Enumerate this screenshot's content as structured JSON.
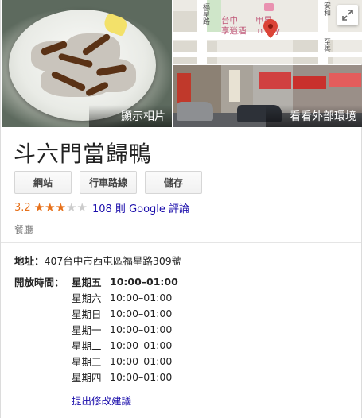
{
  "header": {
    "photo_label": "顯示相片",
    "streetview_label": "看看外部環境",
    "map": {
      "place_label_line1": "台中",
      "place_label_line1b": "甲星",
      "place_label_line2": "享逍酒",
      "place_label_line2b": "n Sky",
      "street_label_1": "福星路",
      "street_label_2": "至善",
      "street_label_3": "安和",
      "pin_color": "#db4437"
    }
  },
  "place": {
    "name": "斗六門當歸鴨",
    "actions": [
      "網站",
      "行車路線",
      "儲存"
    ],
    "rating": "3.2",
    "stars_filled": 3,
    "stars_total": 5,
    "reviews_count": "108",
    "reviews_unit": "則",
    "reviews_text": "Google 評論",
    "category": "餐廳"
  },
  "details": {
    "address_label": "地址：",
    "address": "407台中市西屯區福星路309號",
    "hours_label": "開放時間：",
    "hours": [
      {
        "day": "星期五",
        "time": "10:00–01:00",
        "today": true
      },
      {
        "day": "星期六",
        "time": "10:00–01:00"
      },
      {
        "day": "星期日",
        "time": "10:00–01:00"
      },
      {
        "day": "星期一",
        "time": "10:00–01:00"
      },
      {
        "day": "星期二",
        "time": "10:00–01:00"
      },
      {
        "day": "星期三",
        "time": "10:00–01:00"
      },
      {
        "day": "星期四",
        "time": "10:00–01:00"
      }
    ],
    "suggest_edit": "提出修改建議"
  },
  "colors": {
    "accent_star": "#e7711b",
    "link": "#1a0dab"
  }
}
